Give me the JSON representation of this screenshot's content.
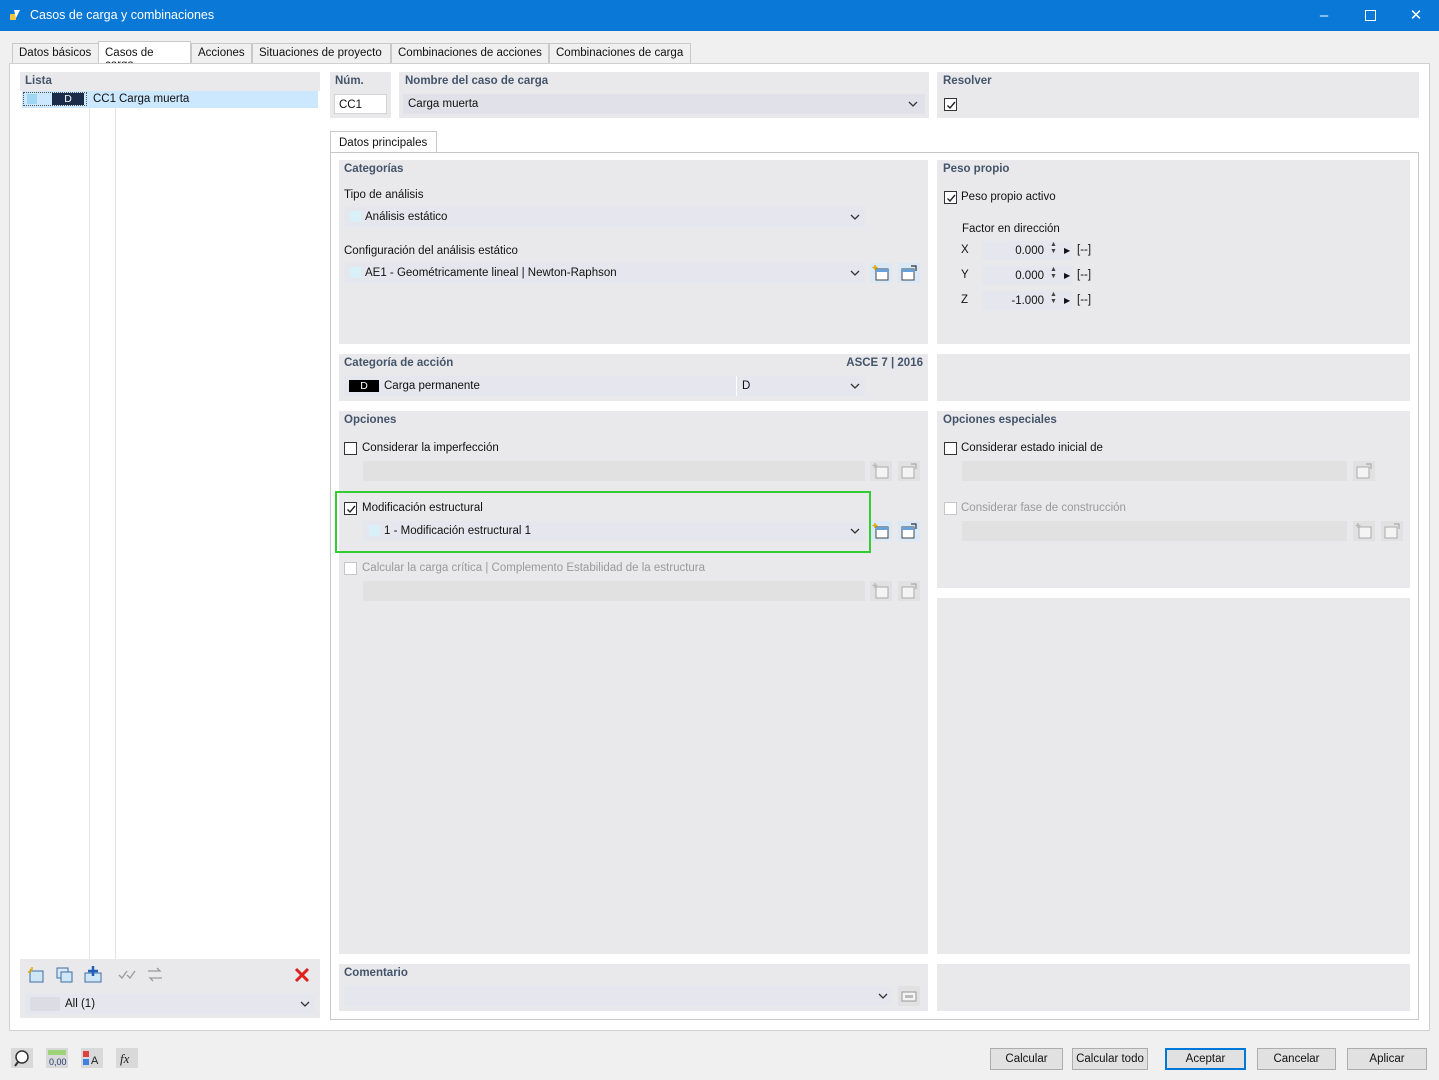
{
  "window": {
    "title": "Casos de carga y combinaciones"
  },
  "tabs": [
    "Datos básicos",
    "Casos de carga",
    "Acciones",
    "Situaciones de proyecto",
    "Combinaciones de acciones",
    "Combinaciones de carga"
  ],
  "list": {
    "header": "Lista",
    "items": [
      {
        "badge": "D",
        "id": "CC1",
        "name": "Carga muerta"
      }
    ],
    "filter": "All (1)"
  },
  "num": {
    "label": "Núm.",
    "value": "CC1"
  },
  "case_name": {
    "label": "Nombre del caso de carga",
    "value": "Carga muerta"
  },
  "resolve": {
    "label": "Resolver",
    "checked": true
  },
  "subtab": "Datos principales",
  "categorias": {
    "header": "Categorías",
    "analysis_label": "Tipo de análisis",
    "analysis_value": "Análisis estático",
    "config_label": "Configuración del análisis estático",
    "config_value": "AE1 - Geométricamente lineal | Newton-Raphson"
  },
  "peso": {
    "header": "Peso propio",
    "active_label": "Peso propio activo",
    "active_checked": true,
    "factor_label": "Factor en dirección",
    "factors": [
      {
        "axis": "X",
        "value": "0.000",
        "unit": "[--]"
      },
      {
        "axis": "Y",
        "value": "0.000",
        "unit": "[--]"
      },
      {
        "axis": "Z",
        "value": "-1.000",
        "unit": "[--]"
      }
    ]
  },
  "accion": {
    "header": "Categoría de acción",
    "standard": "ASCE 7 | 2016",
    "badge": "D",
    "value": "Carga permanente",
    "code": "D"
  },
  "opciones": {
    "header": "Opciones",
    "imperfection_label": "Considerar la imperfección",
    "mod_label": "Modificación estructural",
    "mod_value": "1 - Modificación estructural 1",
    "critical_label": "Calcular la carga crítica | Complemento Estabilidad de la estructura"
  },
  "especiales": {
    "header": "Opciones especiales",
    "initial_label": "Considerar estado inicial de",
    "construction_label": "Considerar fase de construcción"
  },
  "comentario": {
    "header": "Comentario"
  },
  "buttons": {
    "calcular": "Calcular",
    "calcular_todo": "Calcular todo",
    "aceptar": "Aceptar",
    "cancelar": "Cancelar",
    "aplicar": "Aplicar"
  },
  "footer_icons": [
    "help-icon",
    "units-icon",
    "text-style-icon",
    "formula-icon"
  ],
  "colors": {
    "titlebar": "#0a78d7",
    "highlight": "#33cc33",
    "panel": "#e9e9ec",
    "selection": "#cce8ff"
  }
}
